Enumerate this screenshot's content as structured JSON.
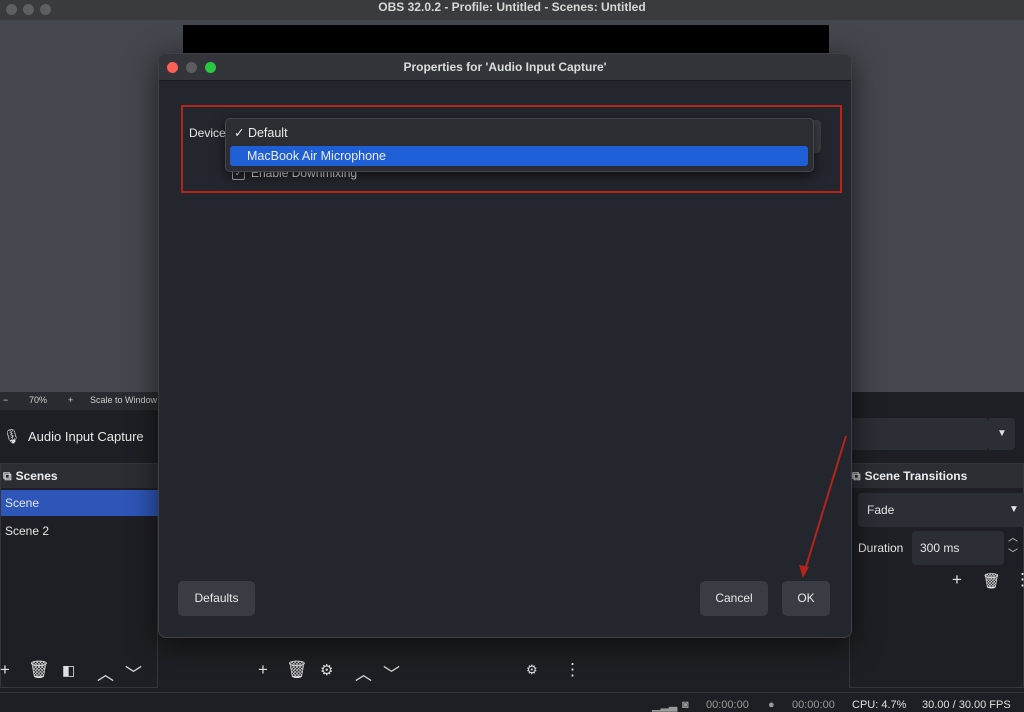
{
  "window": {
    "title": "OBS 32.0.2 - Profile: Untitled - Scenes: Untitled"
  },
  "preview": {
    "zoom": "70%",
    "minus": "−",
    "plus": "+",
    "scale_label": "Scale to Window"
  },
  "source_bar": {
    "source_name": "Audio Input Capture"
  },
  "scenes": {
    "header": "Scenes",
    "items": [
      {
        "label": "Scene"
      },
      {
        "label": "Scene 2"
      }
    ]
  },
  "transitions": {
    "header": "Scene Transitions",
    "selected": "Fade",
    "duration_label": "Duration",
    "duration_value": "300 ms"
  },
  "status": {
    "time1": "00:00:00",
    "time2": "00:00:00",
    "cpu": "CPU: 4.7%",
    "fps": "30.00 / 30.00 FPS"
  },
  "dialog": {
    "title": "Properties for 'Audio Input Capture'",
    "device_label": "Device",
    "options": [
      {
        "label": "✓ Default"
      },
      {
        "label": "MacBook Air Microphone"
      }
    ],
    "downmix_label": "Enable Downmixing",
    "defaults_button": "Defaults",
    "cancel_button": "Cancel",
    "ok_button": "OK"
  },
  "colors": {
    "selection": "#2e56b8",
    "highlight_box": "#b3251c",
    "close_dot": "#fe5f57",
    "minimize_dot": "#febc2e",
    "maximize_dot": "#28c840"
  }
}
